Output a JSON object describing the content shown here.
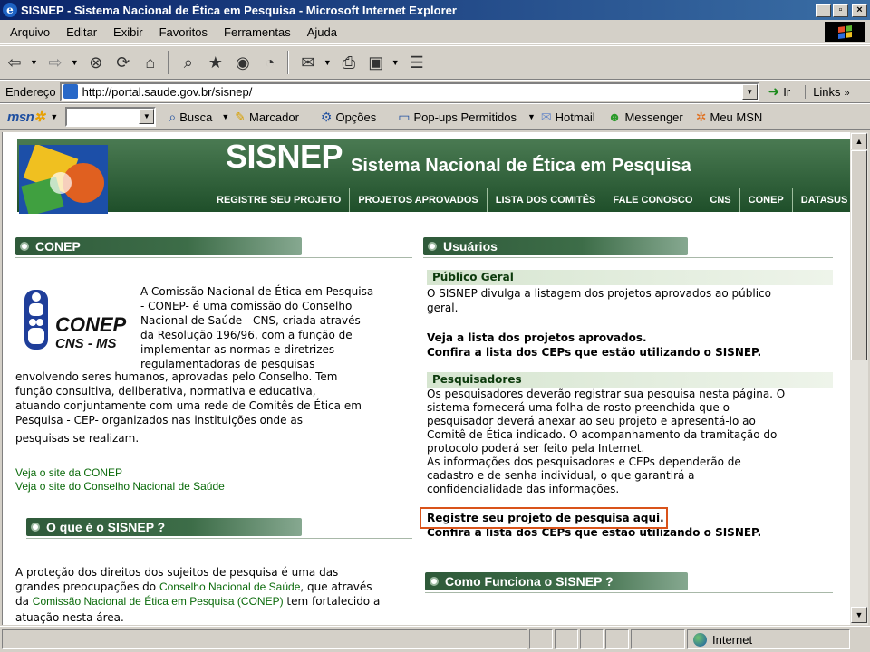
{
  "window": {
    "title": "SISNEP - Sistema Nacional de Ética em Pesquisa - Microsoft Internet Explorer",
    "controls": [
      "_",
      "▫",
      "×"
    ]
  },
  "menu": [
    "Arquivo",
    "Editar",
    "Exibir",
    "Favoritos",
    "Ferramentas",
    "Ajuda"
  ],
  "address": {
    "label": "Endereço",
    "url": "http://portal.saude.gov.br/sisnep/",
    "go": "Ir",
    "links": "Links"
  },
  "msnbar": {
    "brand": "msn",
    "items": [
      {
        "icon": "search-icon",
        "label": "Busca"
      },
      {
        "icon": "highlighter-icon",
        "label": "Marcador"
      },
      {
        "icon": "options-icon",
        "label": "Opções"
      },
      {
        "icon": "popup-icon",
        "label": "Pop-ups Permitidos"
      },
      {
        "icon": "mail-icon",
        "label": "Hotmail"
      },
      {
        "icon": "messenger-icon",
        "label": "Messenger"
      },
      {
        "icon": "butterfly-icon",
        "label": "Meu MSN"
      }
    ]
  },
  "status": {
    "zone": "Internet"
  },
  "page": {
    "logo": "SISNEP",
    "tagline": "Sistema Nacional de Ética em Pesquisa",
    "nav": [
      "REGISTRE SEU PROJETO",
      "PROJETOS APROVADOS",
      "LISTA DOS COMITÊS",
      "FALE CONOSCO",
      "CNS",
      "CONEP",
      "DATASUS"
    ],
    "conep": {
      "heading": "CONEP",
      "logo_text": "CONEP",
      "logo_sub": "CNS - MS",
      "lines_side": [
        "A Comissão Nacional de Ética em Pesquisa",
        "- CONEP- é uma comissão do Conselho",
        "Nacional de Saúde - CNS, criada através",
        "da Resolução 196/96, com a função de",
        "implementar as normas e diretrizes",
        "regulamentadoras de pesquisas"
      ],
      "lines_full": [
        "envolvendo seres humanos, aprovadas pelo Conselho. Tem",
        "função consultiva, deliberativa, normativa e educativa,",
        "atuando conjuntamente com uma rede de Comitês de Ética em",
        "Pesquisa - CEP- organizados nas instituições onde as",
        "pesquisas se realizam."
      ],
      "link1": "Veja o site da CONEP",
      "link2": "Veja o site do Conselho Nacional de Saúde"
    },
    "oque": {
      "heading": "O que é o SISNEP ?",
      "line1": "A proteção dos direitos dos sujeitos de pesquisa é uma das",
      "line2_a": "grandes preocupações do ",
      "line2_link": "Conselho Nacional de Saúde",
      "line2_b": ", que através",
      "line3_a": "da ",
      "line3_link": "Comissão Nacional de Ética em Pesquisa (CONEP)",
      "line3_b": " tem fortalecido a",
      "line4": "atuação nesta área."
    },
    "usuarios": {
      "heading": "Usuários",
      "publico": {
        "title": "Público Geral",
        "lines": [
          "O SISNEP divulga a listagem dos projetos aprovados ao público",
          "geral."
        ],
        "link1": "Veja a lista dos projetos aprovados.",
        "link2": "Confira a lista dos CEPs que estão utilizando o SISNEP."
      },
      "pesquisadores": {
        "title": "Pesquisadores",
        "lines": [
          "Os pesquisadores deverão registrar sua pesquisa nesta página. O",
          "sistema fornecerá uma folha de rosto preenchida que o",
          "pesquisador deverá anexar ao seu projeto e apresentá-lo ao",
          "Comitê de Ética indicado. O acompanhamento da tramitação do",
          "protocolo poderá ser feito pela Internet.",
          "As informações dos pesquisadores e CEPs dependerão de",
          "cadastro e de senha individual, o que garantirá a",
          "confidencialidade das informações."
        ],
        "link1": "Registre seu projeto de pesquisa aqui.",
        "link2": "Confira a lista dos CEPs que estão utilizando o SISNEP."
      }
    },
    "como": {
      "heading": "Como Funciona o SISNEP ?"
    }
  }
}
